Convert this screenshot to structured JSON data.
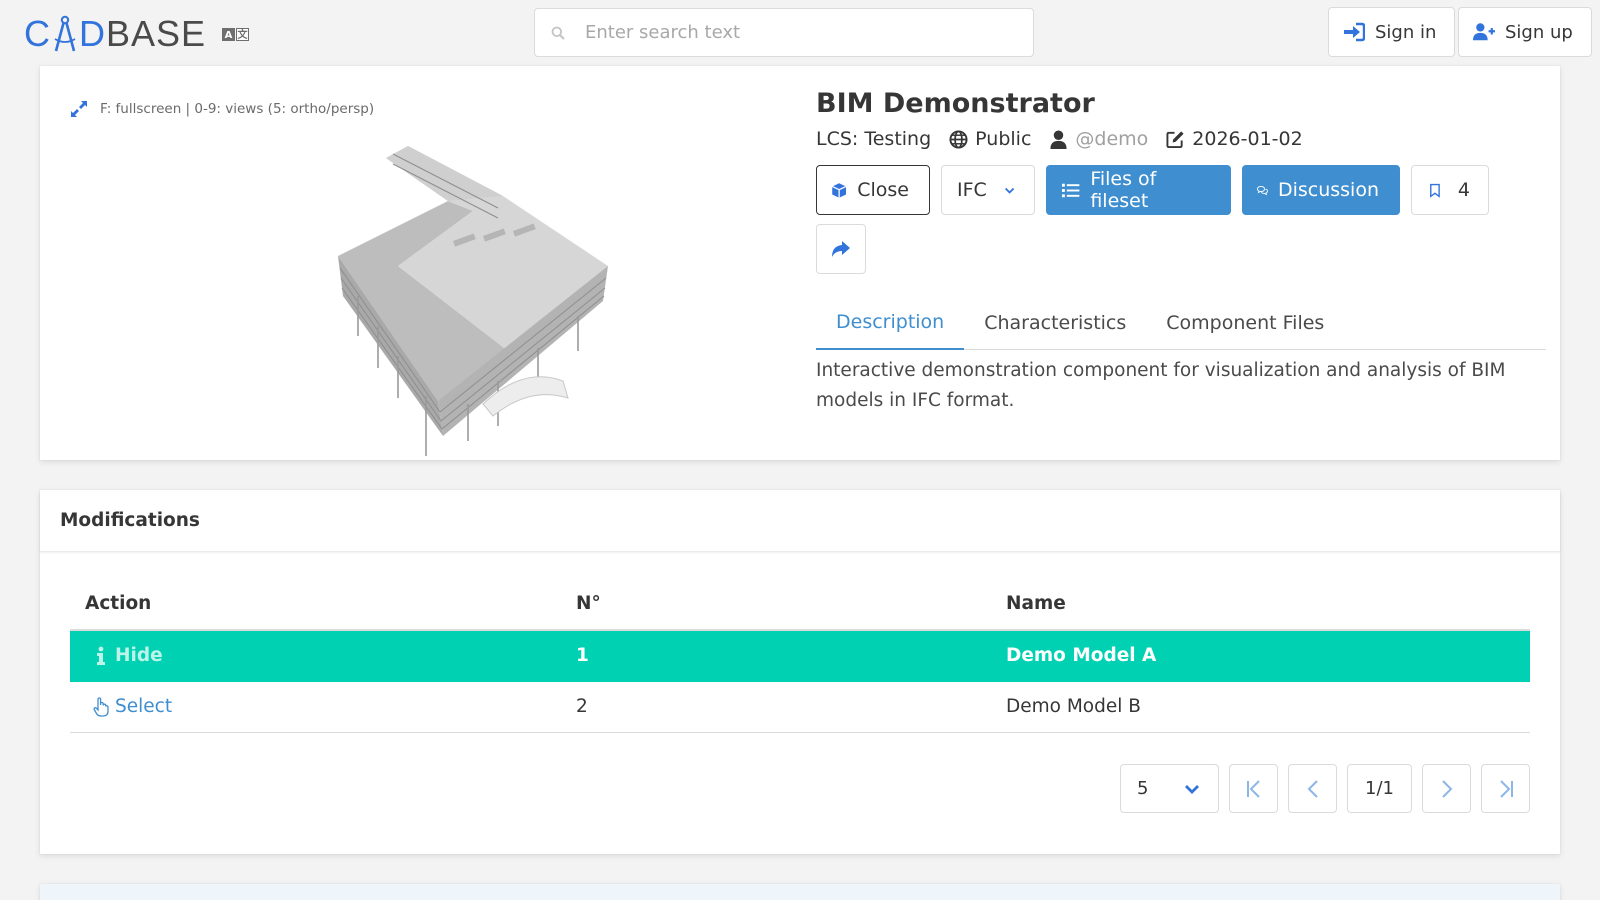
{
  "header": {
    "logo_pre": "C",
    "logo_mid": "D",
    "logo_post": "BASE",
    "search_placeholder": "Enter search text",
    "sign_in": "Sign in",
    "sign_up": "Sign up"
  },
  "viewer": {
    "hint": "F: fullscreen | 0-9: views (5: ortho/persp)"
  },
  "component": {
    "title": "BIM Demonstrator",
    "lcs": "LCS: Testing",
    "visibility": "Public",
    "author": "@demo",
    "date": "2026-01-02",
    "buttons": {
      "close": "Close",
      "format": "IFC",
      "files": "Files of fileset",
      "discussion": "Discussion",
      "bookmark_count": "4"
    },
    "tabs": [
      "Description",
      "Characteristics",
      "Component Files"
    ],
    "description": "Interactive demonstration component for visualization and analysis of BIM models in IFC format."
  },
  "modifications": {
    "title": "Modifications",
    "columns": [
      "Action",
      "N°",
      "Name"
    ],
    "rows": [
      {
        "action": "Hide",
        "no": "1",
        "name": "Demo Model A",
        "selected": true
      },
      {
        "action": "Select",
        "no": "2",
        "name": "Demo Model B",
        "selected": false
      }
    ],
    "pager": {
      "page_size": "5",
      "page": "1/1"
    }
  },
  "colors": {
    "accent": "#3e8ed0",
    "selected_row": "#00d1b2",
    "logo_blue": "#3273dc"
  }
}
